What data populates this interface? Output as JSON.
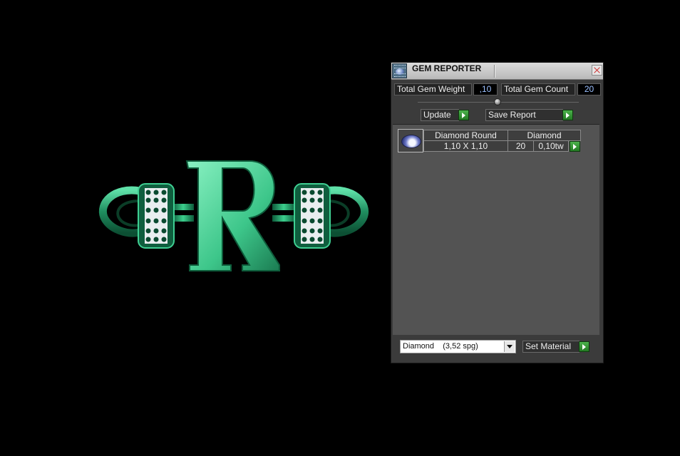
{
  "viewport": {
    "model_icon": "letter-r-ring-model"
  },
  "gem_reporter": {
    "title": "GEM REPORTER",
    "total_weight_label": "Total Gem Weight",
    "total_weight_value": ",10",
    "total_count_label": "Total Gem Count",
    "total_count_value": "20",
    "update_label": "Update",
    "save_report_label": "Save Report",
    "gems": [
      {
        "name": "Diamond Round",
        "material": "Diamond",
        "size": "1,10 X 1,10",
        "count": "20",
        "weight": "0,10tw"
      }
    ],
    "material_select_value": "Diamond    (3,52 spg)",
    "set_material_label": "Set Material"
  },
  "colors": {
    "model_green": "#2fae74",
    "panel_bg": "#3b3b3b",
    "list_bg": "#535353",
    "go_green": "#2f9a2f"
  }
}
